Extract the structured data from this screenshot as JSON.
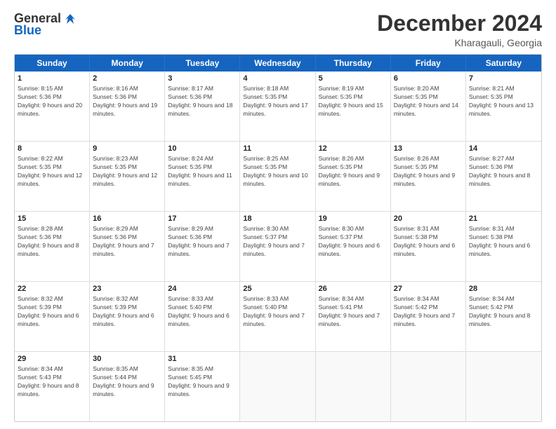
{
  "header": {
    "logo_general": "General",
    "logo_blue": "Blue",
    "month_title": "December 2024",
    "location": "Kharagauli, Georgia"
  },
  "days_of_week": [
    "Sunday",
    "Monday",
    "Tuesday",
    "Wednesday",
    "Thursday",
    "Friday",
    "Saturday"
  ],
  "weeks": [
    [
      {
        "day": "1",
        "info": "Sunrise: 8:15 AM\nSunset: 5:36 PM\nDaylight: 9 hours and 20 minutes."
      },
      {
        "day": "2",
        "info": "Sunrise: 8:16 AM\nSunset: 5:36 PM\nDaylight: 9 hours and 19 minutes."
      },
      {
        "day": "3",
        "info": "Sunrise: 8:17 AM\nSunset: 5:36 PM\nDaylight: 9 hours and 18 minutes."
      },
      {
        "day": "4",
        "info": "Sunrise: 8:18 AM\nSunset: 5:35 PM\nDaylight: 9 hours and 17 minutes."
      },
      {
        "day": "5",
        "info": "Sunrise: 8:19 AM\nSunset: 5:35 PM\nDaylight: 9 hours and 15 minutes."
      },
      {
        "day": "6",
        "info": "Sunrise: 8:20 AM\nSunset: 5:35 PM\nDaylight: 9 hours and 14 minutes."
      },
      {
        "day": "7",
        "info": "Sunrise: 8:21 AM\nSunset: 5:35 PM\nDaylight: 9 hours and 13 minutes."
      }
    ],
    [
      {
        "day": "8",
        "info": "Sunrise: 8:22 AM\nSunset: 5:35 PM\nDaylight: 9 hours and 12 minutes."
      },
      {
        "day": "9",
        "info": "Sunrise: 8:23 AM\nSunset: 5:35 PM\nDaylight: 9 hours and 12 minutes."
      },
      {
        "day": "10",
        "info": "Sunrise: 8:24 AM\nSunset: 5:35 PM\nDaylight: 9 hours and 11 minutes."
      },
      {
        "day": "11",
        "info": "Sunrise: 8:25 AM\nSunset: 5:35 PM\nDaylight: 9 hours and 10 minutes."
      },
      {
        "day": "12",
        "info": "Sunrise: 8:26 AM\nSunset: 5:35 PM\nDaylight: 9 hours and 9 minutes."
      },
      {
        "day": "13",
        "info": "Sunrise: 8:26 AM\nSunset: 5:35 PM\nDaylight: 9 hours and 9 minutes."
      },
      {
        "day": "14",
        "info": "Sunrise: 8:27 AM\nSunset: 5:36 PM\nDaylight: 9 hours and 8 minutes."
      }
    ],
    [
      {
        "day": "15",
        "info": "Sunrise: 8:28 AM\nSunset: 5:36 PM\nDaylight: 9 hours and 8 minutes."
      },
      {
        "day": "16",
        "info": "Sunrise: 8:29 AM\nSunset: 5:36 PM\nDaylight: 9 hours and 7 minutes."
      },
      {
        "day": "17",
        "info": "Sunrise: 8:29 AM\nSunset: 5:36 PM\nDaylight: 9 hours and 7 minutes."
      },
      {
        "day": "18",
        "info": "Sunrise: 8:30 AM\nSunset: 5:37 PM\nDaylight: 9 hours and 7 minutes."
      },
      {
        "day": "19",
        "info": "Sunrise: 8:30 AM\nSunset: 5:37 PM\nDaylight: 9 hours and 6 minutes."
      },
      {
        "day": "20",
        "info": "Sunrise: 8:31 AM\nSunset: 5:38 PM\nDaylight: 9 hours and 6 minutes."
      },
      {
        "day": "21",
        "info": "Sunrise: 8:31 AM\nSunset: 5:38 PM\nDaylight: 9 hours and 6 minutes."
      }
    ],
    [
      {
        "day": "22",
        "info": "Sunrise: 8:32 AM\nSunset: 5:39 PM\nDaylight: 9 hours and 6 minutes."
      },
      {
        "day": "23",
        "info": "Sunrise: 8:32 AM\nSunset: 5:39 PM\nDaylight: 9 hours and 6 minutes."
      },
      {
        "day": "24",
        "info": "Sunrise: 8:33 AM\nSunset: 5:40 PM\nDaylight: 9 hours and 6 minutes."
      },
      {
        "day": "25",
        "info": "Sunrise: 8:33 AM\nSunset: 5:40 PM\nDaylight: 9 hours and 7 minutes."
      },
      {
        "day": "26",
        "info": "Sunrise: 8:34 AM\nSunset: 5:41 PM\nDaylight: 9 hours and 7 minutes."
      },
      {
        "day": "27",
        "info": "Sunrise: 8:34 AM\nSunset: 5:42 PM\nDaylight: 9 hours and 7 minutes."
      },
      {
        "day": "28",
        "info": "Sunrise: 8:34 AM\nSunset: 5:42 PM\nDaylight: 9 hours and 8 minutes."
      }
    ],
    [
      {
        "day": "29",
        "info": "Sunrise: 8:34 AM\nSunset: 5:43 PM\nDaylight: 9 hours and 8 minutes."
      },
      {
        "day": "30",
        "info": "Sunrise: 8:35 AM\nSunset: 5:44 PM\nDaylight: 9 hours and 9 minutes."
      },
      {
        "day": "31",
        "info": "Sunrise: 8:35 AM\nSunset: 5:45 PM\nDaylight: 9 hours and 9 minutes."
      },
      {
        "day": "",
        "info": ""
      },
      {
        "day": "",
        "info": ""
      },
      {
        "day": "",
        "info": ""
      },
      {
        "day": "",
        "info": ""
      }
    ]
  ]
}
